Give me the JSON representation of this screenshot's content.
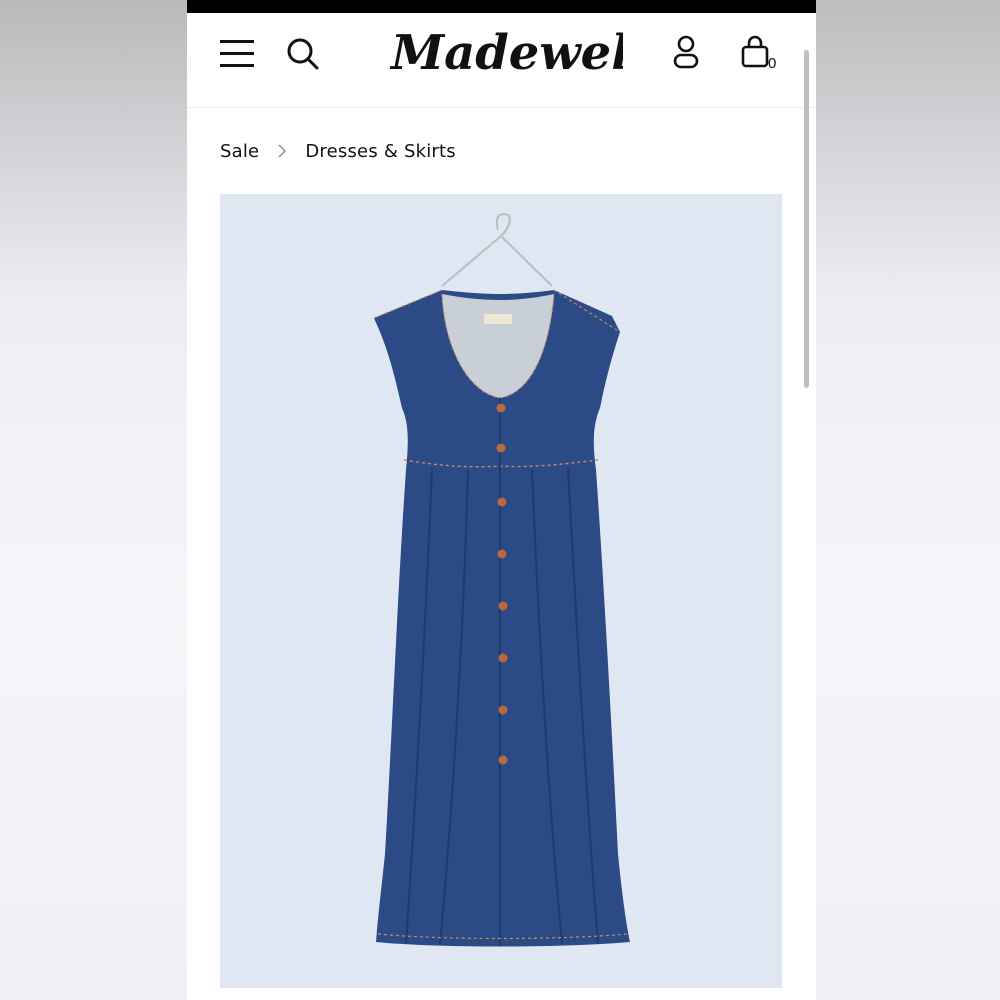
{
  "brand": {
    "logo_text": "Madewell"
  },
  "header": {
    "menu_icon": "hamburger-menu-icon",
    "search_icon": "search-icon",
    "account_icon": "account-icon",
    "bag_icon": "shopping-bag-icon",
    "bag_count": "0"
  },
  "breadcrumb": {
    "items": [
      "Sale",
      "Dresses & Skirts"
    ],
    "separator_icon": "chevron-right-icon"
  },
  "product": {
    "image_background": "#dfe7f3",
    "denim_color": "#2a4a86",
    "button_color": "#b7693d"
  }
}
